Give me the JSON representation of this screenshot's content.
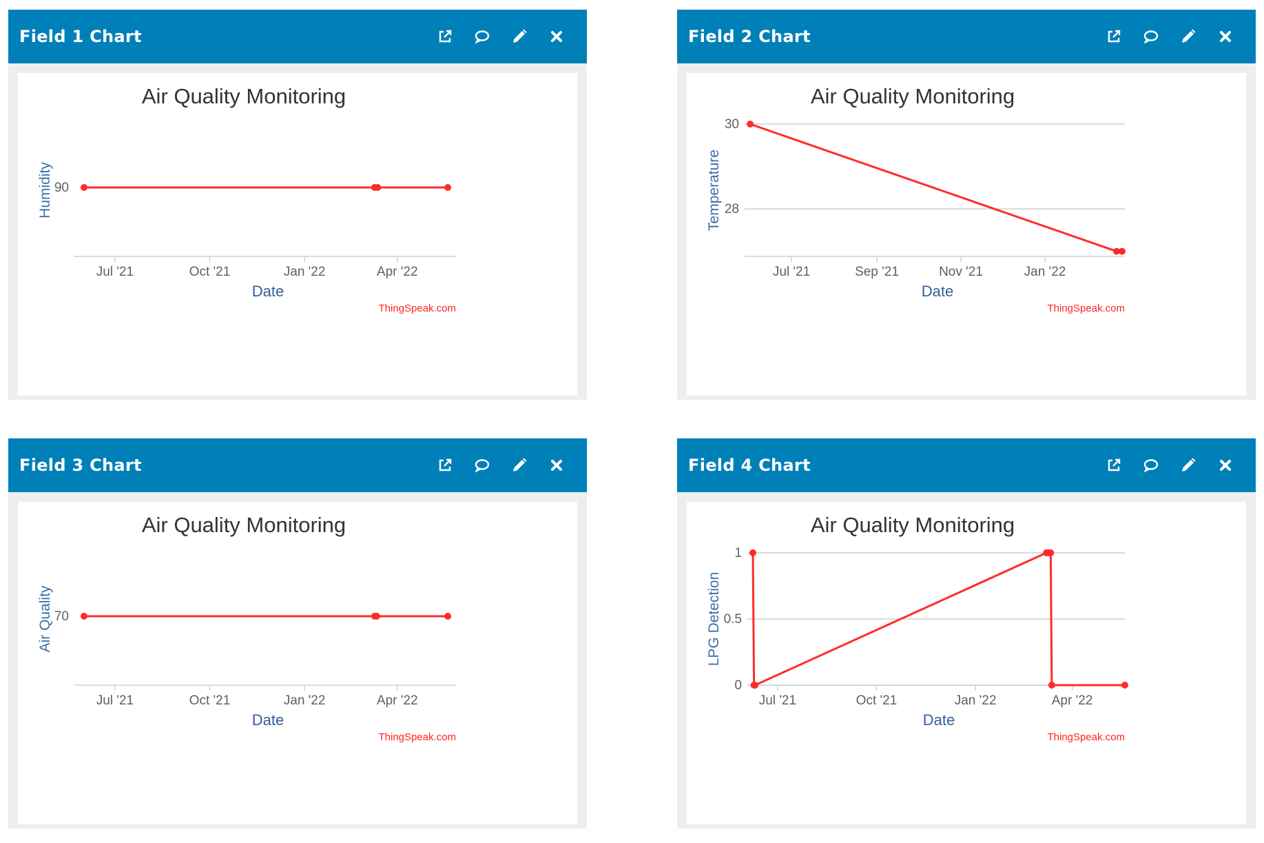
{
  "widgets": [
    {
      "title": "Field 1 Chart",
      "chart_title": "Air Quality Monitoring",
      "credit": "ThingSpeak.com"
    },
    {
      "title": "Field 2 Chart",
      "chart_title": "Air Quality Monitoring",
      "credit": "ThingSpeak.com"
    },
    {
      "title": "Field 3 Chart",
      "chart_title": "Air Quality Monitoring",
      "credit": "ThingSpeak.com"
    },
    {
      "title": "Field 4 Chart",
      "chart_title": "Air Quality Monitoring",
      "credit": "ThingSpeak.com"
    }
  ],
  "icons": [
    "external-link-icon",
    "comment-icon",
    "pencil-icon",
    "close-icon"
  ],
  "colors": {
    "header": "#0080b8",
    "series": "#ff2b2b",
    "axis_label": "#3c6fa8",
    "credit": "#ff2222"
  },
  "chart_data": [
    {
      "type": "line",
      "title": "Air Quality Monitoring",
      "xlabel": "Date",
      "ylabel": "Humidity",
      "x_ticks": [
        "Jul '21",
        "Oct '21",
        "Jan '22",
        "Apr '22"
      ],
      "y_ticks": [
        "90"
      ],
      "grid": false,
      "series": [
        {
          "x": [
            "2021-06-01",
            "2022-03-10",
            "2022-03-13",
            "2022-05-20"
          ],
          "values": [
            90,
            90,
            90,
            90
          ]
        }
      ]
    },
    {
      "type": "line",
      "title": "Air Quality Monitoring",
      "xlabel": "Date",
      "ylabel": "Temperature",
      "x_ticks": [
        "Jul '21",
        "Sep '21",
        "Nov '21",
        "Jan '22"
      ],
      "y_ticks": [
        "28",
        "30"
      ],
      "grid": true,
      "series": [
        {
          "x": [
            "2021-06-01",
            "2022-02-22",
            "2022-02-26"
          ],
          "values": [
            30,
            27,
            27
          ]
        }
      ]
    },
    {
      "type": "line",
      "title": "Air Quality Monitoring",
      "xlabel": "Date",
      "ylabel": "Air Quality",
      "x_ticks": [
        "Jul '21",
        "Oct '21",
        "Jan '22",
        "Apr '22"
      ],
      "y_ticks": [
        "70"
      ],
      "grid": false,
      "series": [
        {
          "x": [
            "2021-06-01",
            "2022-03-10",
            "2022-03-12",
            "2022-05-20"
          ],
          "values": [
            70,
            70,
            70,
            70
          ]
        }
      ]
    },
    {
      "type": "line",
      "title": "Air Quality Monitoring",
      "xlabel": "Date",
      "ylabel": "LPG Detection",
      "x_ticks": [
        "Jul '21",
        "Oct '21",
        "Jan '22",
        "Apr '22"
      ],
      "y_ticks": [
        "0",
        "0.5",
        "1"
      ],
      "grid": true,
      "series": [
        {
          "x": [
            "2021-06-08",
            "2021-06-09",
            "2021-06-10",
            "2022-03-08",
            "2022-03-10",
            "2022-03-12",
            "2022-03-13",
            "2022-05-20"
          ],
          "values": [
            1,
            0,
            0,
            1,
            1,
            1,
            0,
            0
          ]
        }
      ]
    }
  ]
}
